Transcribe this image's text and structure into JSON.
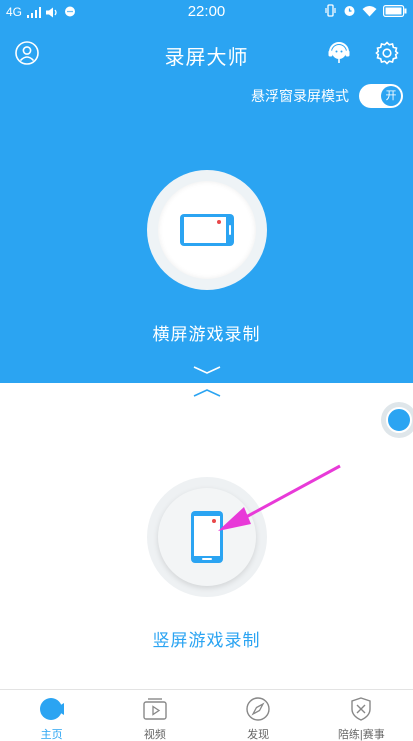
{
  "status_bar": {
    "network": "4G",
    "time": "22:00"
  },
  "header": {
    "title": "录屏大师"
  },
  "floating_mode": {
    "label": "悬浮窗录屏模式",
    "toggle_text": "开",
    "enabled": true
  },
  "landscape": {
    "label": "横屏游戏录制"
  },
  "portrait": {
    "label": "竖屏游戏录制"
  },
  "tabs": [
    {
      "label": "主页",
      "icon": "home-camera-icon",
      "active": true
    },
    {
      "label": "视频",
      "icon": "video-icon",
      "active": false
    },
    {
      "label": "发现",
      "icon": "compass-icon",
      "active": false
    },
    {
      "label": "陪练|赛事",
      "icon": "versus-icon",
      "active": false
    }
  ],
  "colors": {
    "primary": "#2ba4f2",
    "arrow": "#e83ad8",
    "record_dot": "#e8484a"
  }
}
